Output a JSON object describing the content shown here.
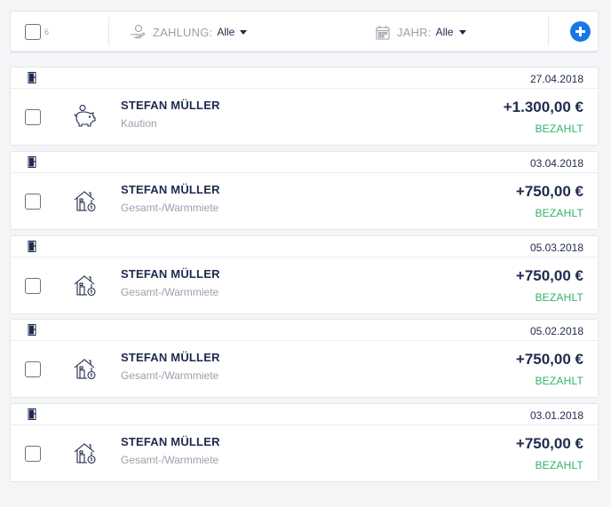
{
  "toolbar": {
    "count": "6",
    "filter_payment": {
      "label": "ZAHLUNG:",
      "value": "Alle"
    },
    "filter_year": {
      "label": "JAHR:",
      "value": "Alle"
    }
  },
  "payments": [
    {
      "date": "27.04.2018",
      "name": "STEFAN MÜLLER",
      "category": "Kaution",
      "icon": "piggy-bank-icon",
      "amount": "+1.300,00 €",
      "status": "BEZAHLT"
    },
    {
      "date": "03.04.2018",
      "name": "STEFAN MÜLLER",
      "category": "Gesamt-/Warmmiete",
      "icon": "house-rent-icon",
      "amount": "+750,00 €",
      "status": "BEZAHLT"
    },
    {
      "date": "05.03.2018",
      "name": "STEFAN MÜLLER",
      "category": "Gesamt-/Warmmiete",
      "icon": "house-rent-icon",
      "amount": "+750,00 €",
      "status": "BEZAHLT"
    },
    {
      "date": "05.02.2018",
      "name": "STEFAN MÜLLER",
      "category": "Gesamt-/Warmmiete",
      "icon": "house-rent-icon",
      "amount": "+750,00 €",
      "status": "BEZAHLT"
    },
    {
      "date": "03.01.2018",
      "name": "STEFAN MÜLLER",
      "category": "Gesamt-/Warmmiete",
      "icon": "house-rent-icon",
      "amount": "+750,00 €",
      "status": "BEZAHLT"
    }
  ],
  "colors": {
    "accent": "#1877e6",
    "paid": "#2fb36b",
    "text": "#1f2a4d",
    "muted": "#9aa1ad"
  }
}
